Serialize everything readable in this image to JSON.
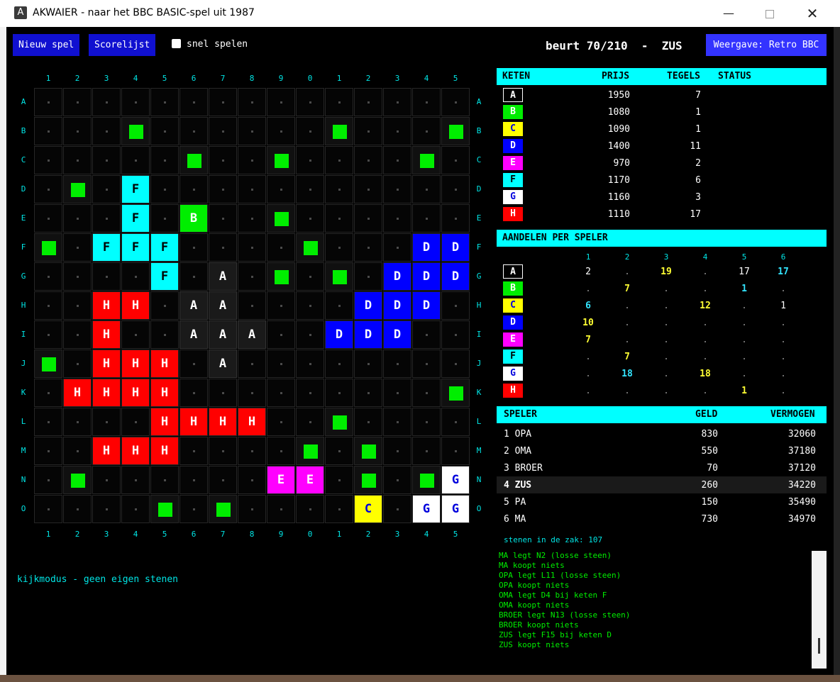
{
  "window": {
    "title": "AKWAIER  -  naar het BBC BASIC-spel uit 1987",
    "icon_letter": "A",
    "controls": [
      "minimize-icon",
      "maximize-icon",
      "close-icon"
    ]
  },
  "toolbar": {
    "new_game": "Nieuw spel",
    "scorelist": "Scorelijst",
    "fast_play_label": "snel spelen",
    "fast_play_checked": false,
    "turn_text": "beurt 70/210  -  ZUS",
    "view_button": "Weergave: Retro BBC"
  },
  "board": {
    "columns": [
      "1",
      "2",
      "3",
      "4",
      "5",
      "6",
      "7",
      "8",
      "9",
      "0",
      "1",
      "2",
      "3",
      "4",
      "5"
    ],
    "rows": [
      "A",
      "B",
      "C",
      "D",
      "E",
      "F",
      "G",
      "H",
      "I",
      "J",
      "K",
      "L",
      "M",
      "N",
      "O"
    ],
    "cells": [
      "...............",
      "...L......L...L",
      ".....L..L....L.",
      ".L.F...........",
      "...F.B..L......",
      "L.FFF....L...DD",
      "....F.A.L.L.DDD",
      "..HH.AA....DDD.",
      "..H..AAA..DDD..",
      "L.HHH.A........",
      ".HHHH.........L",
      "....HHHH..L....",
      "..HHH....L.L...",
      ".L......EE.L.LG",
      "....L.L....C.GG"
    ],
    "legend": {
      "L": "loose-tile",
      ".": "empty"
    }
  },
  "chain_colors": {
    "A": {
      "bg": "#000000",
      "fg": "#ffffff",
      "border": "#ffffff"
    },
    "B": {
      "bg": "#00ee00",
      "fg": "#ffffff"
    },
    "C": {
      "bg": "#ffff00",
      "fg": "#0000dd"
    },
    "D": {
      "bg": "#0000ff",
      "fg": "#ffffff"
    },
    "E": {
      "bg": "#ff00ff",
      "fg": "#ffffff"
    },
    "F": {
      "bg": "#00ffff",
      "fg": "#000000"
    },
    "G": {
      "bg": "#ffffff",
      "fg": "#0000dd"
    },
    "H": {
      "bg": "#ff0000",
      "fg": "#ffffff"
    }
  },
  "status_message": "kijkmodus - geen eigen stenen",
  "chains_table": {
    "headers": [
      "KETEN",
      "PRIJS",
      "TEGELS",
      "STATUS"
    ],
    "rows": [
      {
        "chain": "A",
        "price": "1950",
        "tiles": "7",
        "status": ""
      },
      {
        "chain": "B",
        "price": "1080",
        "tiles": "1",
        "status": ""
      },
      {
        "chain": "C",
        "price": "1090",
        "tiles": "1",
        "status": ""
      },
      {
        "chain": "D",
        "price": "1400",
        "tiles": "11",
        "status": ""
      },
      {
        "chain": "E",
        "price": "970",
        "tiles": "2",
        "status": ""
      },
      {
        "chain": "F",
        "price": "1170",
        "tiles": "6",
        "status": ""
      },
      {
        "chain": "G",
        "price": "1160",
        "tiles": "3",
        "status": ""
      },
      {
        "chain": "H",
        "price": "1110",
        "tiles": "17",
        "status": ""
      }
    ]
  },
  "shares_table": {
    "header": "AANDELEN PER SPELER",
    "player_numbers": [
      "1",
      "2",
      "3",
      "4",
      "5",
      "6"
    ],
    "rows": [
      {
        "chain": "A",
        "cells": [
          {
            "v": "2",
            "c": "#ffffff"
          },
          {
            "v": ".",
            "c": "#888888"
          },
          {
            "v": "19",
            "c": "#ffff33"
          },
          {
            "v": ".",
            "c": "#888888"
          },
          {
            "v": "17",
            "c": "#ffffff"
          },
          {
            "v": "17",
            "c": "#33e5ff"
          }
        ]
      },
      {
        "chain": "B",
        "cells": [
          {
            "v": ".",
            "c": "#888888"
          },
          {
            "v": "7",
            "c": "#ffff33"
          },
          {
            "v": ".",
            "c": "#888888"
          },
          {
            "v": ".",
            "c": "#888888"
          },
          {
            "v": "1",
            "c": "#33e5ff"
          },
          {
            "v": ".",
            "c": "#888888"
          }
        ]
      },
      {
        "chain": "C",
        "cells": [
          {
            "v": "6",
            "c": "#33e5ff"
          },
          {
            "v": ".",
            "c": "#888888"
          },
          {
            "v": ".",
            "c": "#888888"
          },
          {
            "v": "12",
            "c": "#ffff33"
          },
          {
            "v": ".",
            "c": "#888888"
          },
          {
            "v": "1",
            "c": "#ffffff"
          }
        ]
      },
      {
        "chain": "D",
        "cells": [
          {
            "v": "10",
            "c": "#ffff33"
          },
          {
            "v": ".",
            "c": "#888888"
          },
          {
            "v": ".",
            "c": "#888888"
          },
          {
            "v": ".",
            "c": "#888888"
          },
          {
            "v": ".",
            "c": "#888888"
          },
          {
            "v": ".",
            "c": "#888888"
          }
        ]
      },
      {
        "chain": "E",
        "cells": [
          {
            "v": "7",
            "c": "#ffff33"
          },
          {
            "v": ".",
            "c": "#888888"
          },
          {
            "v": ".",
            "c": "#888888"
          },
          {
            "v": ".",
            "c": "#888888"
          },
          {
            "v": ".",
            "c": "#888888"
          },
          {
            "v": ".",
            "c": "#888888"
          }
        ]
      },
      {
        "chain": "F",
        "cells": [
          {
            "v": ".",
            "c": "#888888"
          },
          {
            "v": "7",
            "c": "#ffff33"
          },
          {
            "v": ".",
            "c": "#888888"
          },
          {
            "v": ".",
            "c": "#888888"
          },
          {
            "v": ".",
            "c": "#888888"
          },
          {
            "v": ".",
            "c": "#888888"
          }
        ]
      },
      {
        "chain": "G",
        "cells": [
          {
            "v": ".",
            "c": "#888888"
          },
          {
            "v": "18",
            "c": "#33e5ff"
          },
          {
            "v": ".",
            "c": "#888888"
          },
          {
            "v": "18",
            "c": "#ffff33"
          },
          {
            "v": ".",
            "c": "#888888"
          },
          {
            "v": ".",
            "c": "#888888"
          }
        ]
      },
      {
        "chain": "H",
        "cells": [
          {
            "v": ".",
            "c": "#888888"
          },
          {
            "v": ".",
            "c": "#888888"
          },
          {
            "v": ".",
            "c": "#888888"
          },
          {
            "v": ".",
            "c": "#888888"
          },
          {
            "v": "1",
            "c": "#ffff33"
          },
          {
            "v": ".",
            "c": "#888888"
          }
        ]
      }
    ]
  },
  "players_table": {
    "headers": [
      "SPELER",
      "GELD",
      "VERMOGEN"
    ],
    "rows": [
      {
        "name": "1 OPA",
        "money": "830",
        "worth": "32060",
        "current": false
      },
      {
        "name": "2 OMA",
        "money": "550",
        "worth": "37180",
        "current": false
      },
      {
        "name": "3 BROER",
        "money": "70",
        "worth": "37120",
        "current": false
      },
      {
        "name": "4 ZUS",
        "money": "260",
        "worth": "34220",
        "current": true
      },
      {
        "name": "5 PA",
        "money": "150",
        "worth": "35490",
        "current": false
      },
      {
        "name": "6 MA",
        "money": "730",
        "worth": "34970",
        "current": false
      }
    ]
  },
  "tiles_in_bag": "stenen in de zak: 107",
  "log": [
    "MA legt N2 (losse steen)",
    "MA koopt niets",
    "OPA legt L11 (losse steen)",
    "OPA koopt niets",
    "OMA legt D4 bij keten F",
    "OMA koopt niets",
    "BROER legt N13 (losse steen)",
    "BROER koopt niets",
    "ZUS legt F15 bij keten D",
    "ZUS koopt niets"
  ]
}
